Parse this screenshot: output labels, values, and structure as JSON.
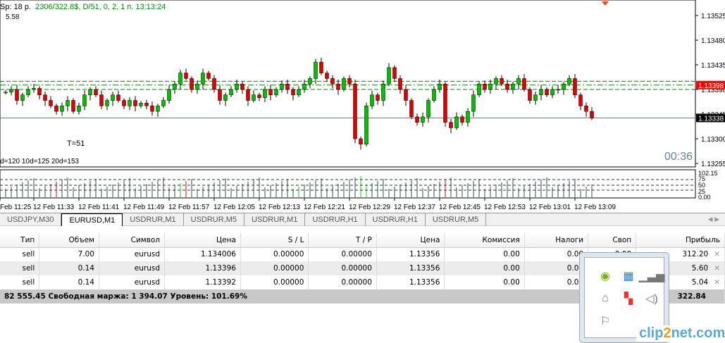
{
  "header": {
    "spread": "Sp: 18 p.",
    "stats": "2306/322.8$, D/51,  0, 2, 1 п.  13:13:24",
    "sub": "5.58",
    "timer": "T=51",
    "ranges": "d=120  10d=125  20d=153",
    "countdown": "00:36"
  },
  "price_axis": {
    "ticks": [
      "1.13525",
      "1.13480",
      "1.13435",
      "1.13390",
      "1.13345",
      "1.13300",
      "1.13255"
    ],
    "bid_marker": "1.13398",
    "ask_marker": "1.13338",
    "bid_color": "#ff0000",
    "ask_color": "#000000"
  },
  "volume_axis": {
    "ticks": [
      "102.15",
      "75",
      "50",
      "25",
      "0.00"
    ]
  },
  "time_axis": [
    "Feb 11:25",
    "12 Feb 11:33",
    "12 Feb 11:41",
    "12 Feb 11:49",
    "12 Feb 11:57",
    "12 Feb 12:05",
    "12 Feb 12:13",
    "12 Feb 12:21",
    "12 Feb 12:29",
    "12 Feb 12:37",
    "12 Feb 12:45",
    "12 Feb 12:53",
    "12 Feb 13:01",
    "12 Feb 13:09"
  ],
  "chart_data": {
    "type": "candlestick",
    "closes": [
      1.13385,
      1.1339,
      1.1337,
      1.1338,
      1.1339,
      1.13392,
      1.1338,
      1.1337,
      1.1336,
      1.1335,
      1.1336,
      1.1337,
      1.1335,
      1.1336,
      1.1338,
      1.1339,
      1.1338,
      1.1336,
      1.1337,
      1.1338,
      1.1337,
      1.1336,
      1.1337,
      1.1336,
      1.13365,
      1.1336,
      1.1335,
      1.1336,
      1.1337,
      1.1339,
      1.134,
      1.1342,
      1.1341,
      1.1339,
      1.134,
      1.1342,
      1.1341,
      1.1339,
      1.1337,
      1.1338,
      1.1339,
      1.134,
      1.1339,
      1.1337,
      1.1338,
      1.13375,
      1.1339,
      1.1338,
      1.1339,
      1.134,
      1.1339,
      1.1338,
      1.1339,
      1.134,
      1.1341,
      1.1344,
      1.1342,
      1.1341,
      1.134,
      1.1339,
      1.1341,
      1.134,
      1.133,
      1.1329,
      1.1336,
      1.1338,
      1.1337,
      1.134,
      1.1343,
      1.1341,
      1.1339,
      1.1337,
      1.1334,
      1.1333,
      1.1334,
      1.1337,
      1.1339,
      1.134,
      1.1333,
      1.1332,
      1.1334,
      1.1333,
      1.1335,
      1.1338,
      1.134,
      1.1339,
      1.134,
      1.1341,
      1.134,
      1.1339,
      1.134,
      1.1341,
      1.1339,
      1.1337,
      1.1338,
      1.1339,
      1.1338,
      1.1339,
      1.1339,
      1.134,
      1.1341,
      1.1338,
      1.1336,
      1.1335,
      1.13338
    ],
    "green_levels": [
      1.13405,
      1.13398,
      1.1339
    ],
    "orange_level": 1.13338
  },
  "tabs": [
    "USDJPY,M30",
    "EURUSD,M1",
    "USDRUR,M1",
    "USDRUR,M5",
    "USDRUR,M1",
    "USDRUR,H1",
    "USDRUR,H1",
    "USDRUR,M5"
  ],
  "table": {
    "headers": [
      "Тип",
      "Объем",
      "Символ",
      "Цена",
      "S / L",
      "T / P",
      "Цена",
      "Комиссия",
      "Налоги",
      "Своп",
      "Прибыль"
    ],
    "rows": [
      [
        "sell",
        "7.00",
        "eurusd",
        "1.134006",
        "0.00000",
        "0.00000",
        "1.13356",
        "0.00",
        "0.00",
        "0.00",
        "312.20"
      ],
      [
        "sell",
        "0.14",
        "eurusd",
        "1.13396",
        "0.00000",
        "0.00000",
        "1.13356",
        "0.00",
        "0.00",
        "0.00",
        "5.60"
      ],
      [
        "sell",
        "0.14",
        "eurusd",
        "1.13392",
        "0.00000",
        "0.00000",
        "1.13356",
        "0.00",
        "0.00",
        "0.00",
        "5.04"
      ]
    ],
    "summary": "82 555.45  Свободная маржа: 1 394.07  Уровень: 101.69%",
    "total": "322.84"
  },
  "tray": [
    "nvidia-icon",
    "update-icon",
    "signal-icon",
    "network-icon",
    "windows-icon",
    "speaker-icon",
    "flag-icon"
  ],
  "watermark": {
    "a": "clip",
    "b": "2",
    "c": "net.com"
  }
}
